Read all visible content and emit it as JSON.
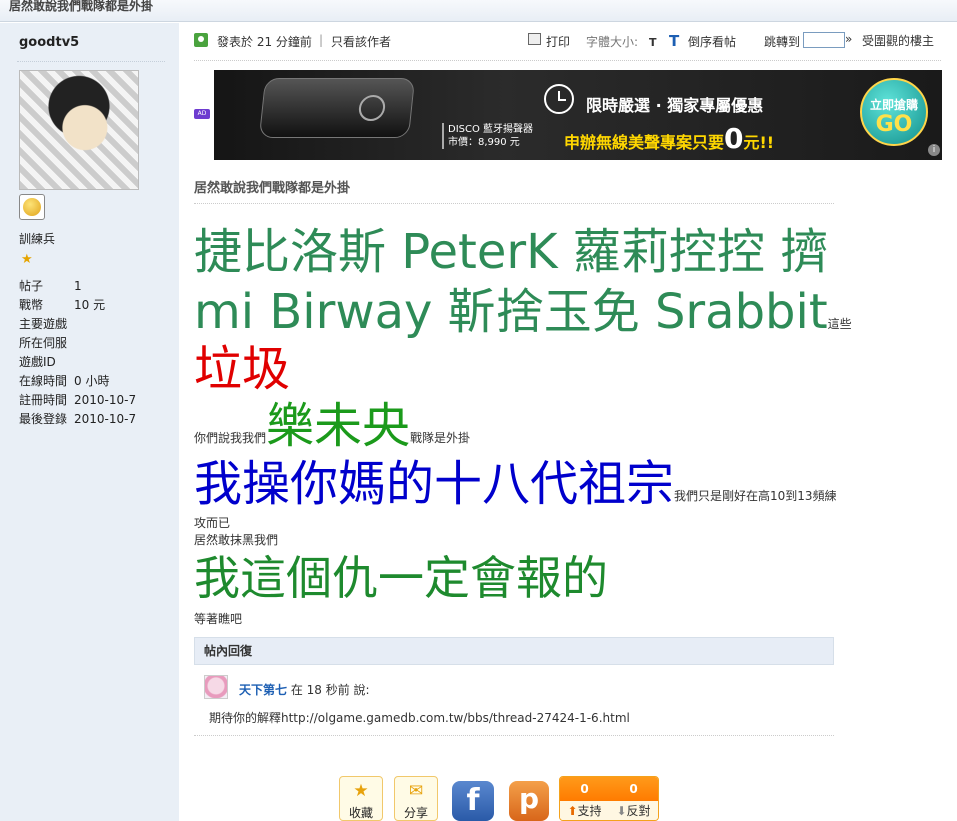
{
  "page": {
    "title": "居然敢說我們戰隊都是外掛"
  },
  "sidebar": {
    "username": "goodtv5",
    "rank": "訓練兵",
    "info": [
      {
        "label": "帖子",
        "value": "1"
      },
      {
        "label": "戰幣",
        "value": "10 元"
      },
      {
        "label": "主要遊戲",
        "value": ""
      },
      {
        "label": "所在伺服",
        "value": ""
      },
      {
        "label": "遊戲ID",
        "value": ""
      },
      {
        "label": "在線時間",
        "value": "0 小時"
      },
      {
        "label": "註冊時間",
        "value": "2010-10-7"
      },
      {
        "label": "最後登錄",
        "value": "2010-10-7"
      }
    ]
  },
  "meta": {
    "posted": "發表於 21 分鐘前",
    "separator": "|",
    "author_only": "只看該作者",
    "print": "打印",
    "font_size": "字體大小:",
    "font_small": "T",
    "font_big": "T",
    "reverse": "倒序看帖",
    "jump": "跳轉到",
    "jump_go": "»",
    "received": "受圍觀的樓主"
  },
  "ad": {
    "tag": "AD",
    "product": "DISCO 藍牙揚聲器",
    "price": "市價：8,990 元",
    "headline": "限時嚴選 · 獨家專屬優惠",
    "offer_prefix": "申辦無線美聲專案只要",
    "offer_zero": "0",
    "offer_suffix": "元!!",
    "go_sub": "立即搶購",
    "go_main": "GO",
    "info": "i"
  },
  "post": {
    "title": "居然敢說我們戰隊都是外掛",
    "line1": "捷比洛斯 PeterK 蘿莉控控 擠",
    "line2": "mi Birway 靳捨玉免 Srabbit",
    "line2_small": "這些",
    "line3": "垃圾",
    "line4_pre": "你們說我我們",
    "line4_big": "樂未央",
    "line4_post": "戰隊是外掛",
    "line5_big": "我操你媽的十八代祖宗",
    "line5_small": "我們只是剛好在高10到13頻練",
    "line6": "攻而已",
    "line7": "居然敢抹黑我們",
    "line8": "我這個仇一定會報的",
    "line9": "等著瞧吧"
  },
  "reply": {
    "header": "帖內回復",
    "user": "天下第七",
    "time": " 在 18 秒前 說:",
    "body": "期待你的解釋http://olgame.gamedb.com.tw/bbs/thread-27424-1-6.html"
  },
  "actions": {
    "favorite": "收藏",
    "share": "分享",
    "facebook": "f",
    "plurk": "p",
    "support_count": "0",
    "oppose_count": "0",
    "support": "支持",
    "oppose": "反對"
  }
}
